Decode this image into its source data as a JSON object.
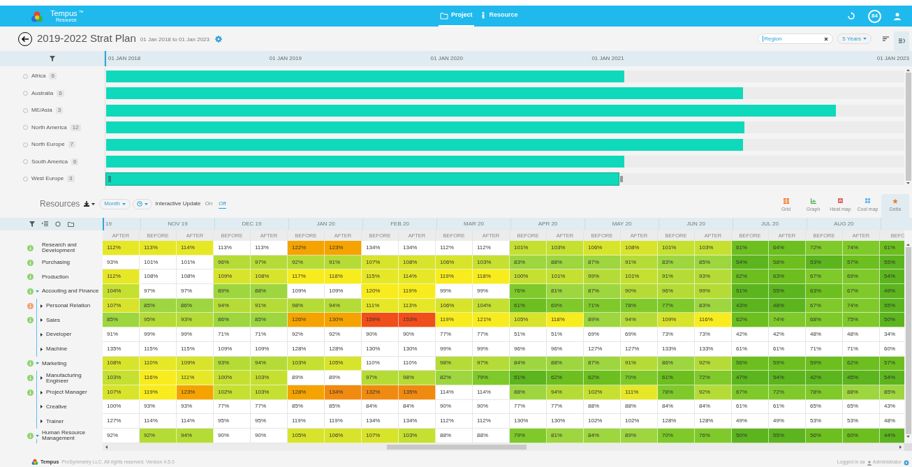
{
  "app": {
    "name": "Tempus",
    "trademark": "™",
    "subtitle": "Resource"
  },
  "nav_tabs": [
    {
      "label": "Project",
      "selected": true
    },
    {
      "label": "Resource",
      "selected": false
    }
  ],
  "notification_count": "84",
  "plan": {
    "title": "2019-2022 Strat Plan",
    "dates": "01 Jan 2018 to 01 Jan 2023"
  },
  "search": {
    "value": "Region"
  },
  "range_dropdown": "5 Years",
  "timeline": {
    "ticks": [
      "01 JAN 2018",
      "01 JAN 2019",
      "01 JAN 2020",
      "01 JAN 2021",
      "01 JAN 2023"
    ]
  },
  "regions": [
    {
      "name": "Africa",
      "count": "6",
      "checked": false,
      "selected": false,
      "level": 0.649
    },
    {
      "name": "Australia",
      "count": "6",
      "checked": false,
      "selected": false,
      "level": 0.798
    },
    {
      "name": "ME/Asia",
      "count": "3",
      "checked": false,
      "selected": false,
      "level": 0.914
    },
    {
      "name": "North America",
      "count": "12",
      "checked": false,
      "selected": false,
      "level": 0.8
    },
    {
      "name": "North Europe",
      "count": "7",
      "checked": false,
      "selected": false,
      "level": 0.798
    },
    {
      "name": "South America",
      "count": "6",
      "checked": false,
      "selected": false,
      "level": 0.649
    },
    {
      "name": "West Europe",
      "count": "3",
      "checked": false,
      "selected": true,
      "level": 0.642
    }
  ],
  "resources": {
    "title": "Resources",
    "period_dropdown": "Month",
    "interactive_update": {
      "label": "Interactive Update",
      "options": [
        {
          "label": "On",
          "selected": false
        },
        {
          "label": "Off",
          "selected": true
        }
      ]
    },
    "views": [
      {
        "label": "Grid",
        "selected": false
      },
      {
        "label": "Graph",
        "selected": false
      },
      {
        "label": "Heat map",
        "selected": false
      },
      {
        "label": "Cool map",
        "selected": false
      },
      {
        "label": "Delta",
        "selected": true
      }
    ],
    "months": [
      {
        "label": "19",
        "columns": [
          "AFTER"
        ]
      },
      {
        "label": "NOV 19",
        "columns": [
          "BEFORE",
          "AFTER"
        ]
      },
      {
        "label": "DEC 19",
        "columns": [
          "BEFORE",
          "AFTER"
        ]
      },
      {
        "label": "JAN 20",
        "columns": [
          "BEFORE",
          "AFTER"
        ]
      },
      {
        "label": "FEB 20",
        "columns": [
          "BEFORE",
          "AFTER"
        ]
      },
      {
        "label": "MAR 20",
        "columns": [
          "BEFORE",
          "AFTER"
        ]
      },
      {
        "label": "APR 20",
        "columns": [
          "BEFORE",
          "AFTER"
        ]
      },
      {
        "label": "MAY 20",
        "columns": [
          "BEFORE",
          "AFTER"
        ]
      },
      {
        "label": "JUN 20",
        "columns": [
          "BEFORE",
          "AFTER"
        ]
      },
      {
        "label": "JUL 20",
        "columns": [
          "BEFORE",
          "AFTER"
        ]
      },
      {
        "label": "AUG 20",
        "columns": [
          "BEFORE",
          "AFTER"
        ]
      },
      {
        "columns": [
          "BEFO"
        ]
      }
    ],
    "rows": [
      {
        "name": "Research and Development",
        "kind": "info",
        "cells": [
          {
            "value": "112%",
            "color": "#e6e827"
          },
          {
            "value": "113%",
            "color": "#e6e827"
          },
          {
            "value": "114%",
            "color": "#e6e827"
          },
          {
            "value": "113%"
          },
          {
            "value": "113%"
          },
          {
            "value": "122%",
            "color": "#f5a300"
          },
          {
            "value": "123%",
            "color": "#f5a300"
          },
          {
            "value": "134%"
          },
          {
            "value": "134%"
          },
          {
            "value": "112%"
          },
          {
            "value": "112%"
          },
          {
            "value": "101%",
            "color": "#c5e031"
          },
          {
            "value": "103%",
            "color": "#c5e031"
          },
          {
            "value": "106%",
            "color": "#d8e42b"
          },
          {
            "value": "108%",
            "color": "#d8e42b"
          },
          {
            "value": "101%",
            "color": "#c5e031"
          },
          {
            "value": "103%",
            "color": "#c5e031"
          },
          {
            "value": "61%",
            "color": "#6cbf1f"
          },
          {
            "value": "64%",
            "color": "#6cbf1f"
          },
          {
            "value": "72%",
            "color": "#7fca2a"
          },
          {
            "value": "74%",
            "color": "#7fca2a"
          },
          {
            "value": "61%",
            "color": "#6cbf1f"
          }
        ]
      },
      {
        "name": "Purchasing",
        "kind": "info",
        "cells": [
          {
            "value": "93%"
          },
          {
            "value": "101%"
          },
          {
            "value": "101%"
          },
          {
            "value": "96%",
            "color": "#b5dc36"
          },
          {
            "value": "97%",
            "color": "#b5dc36"
          },
          {
            "value": "92%",
            "color": "#b5dc36"
          },
          {
            "value": "91%",
            "color": "#b5dc36"
          },
          {
            "value": "107%",
            "color": "#d8e42b"
          },
          {
            "value": "108%",
            "color": "#d8e42b"
          },
          {
            "value": "106%",
            "color": "#d8e42b"
          },
          {
            "value": "103%",
            "color": "#c5e031"
          },
          {
            "value": "83%",
            "color": "#9ed63f"
          },
          {
            "value": "88%",
            "color": "#9ed63f"
          },
          {
            "value": "87%",
            "color": "#9ed63f"
          },
          {
            "value": "91%",
            "color": "#b5dc36"
          },
          {
            "value": "83%",
            "color": "#9ed63f"
          },
          {
            "value": "85%",
            "color": "#9ed63f"
          },
          {
            "value": "54%",
            "color": "#5cb51e"
          },
          {
            "value": "58%",
            "color": "#6cbf1f"
          },
          {
            "value": "53%",
            "color": "#5cb51e"
          },
          {
            "value": "57%",
            "color": "#6cbf1f"
          },
          {
            "value": "55%",
            "color": "#5cb51e"
          }
        ]
      },
      {
        "name": "Production",
        "kind": "info",
        "cells": [
          {
            "value": "112%",
            "color": "#e6e827"
          },
          {
            "value": "108%"
          },
          {
            "value": "108%"
          },
          {
            "value": "109%",
            "color": "#d8e42b"
          },
          {
            "value": "108%",
            "color": "#d8e42b"
          },
          {
            "value": "117%",
            "color": "#f8ec1e"
          },
          {
            "value": "118%",
            "color": "#f8ec1e"
          },
          {
            "value": "115%",
            "color": "#e6e827"
          },
          {
            "value": "114%",
            "color": "#e6e827"
          },
          {
            "value": "119%",
            "color": "#f8ec1e"
          },
          {
            "value": "118%",
            "color": "#f8ec1e"
          },
          {
            "value": "100%",
            "color": "#c5e031"
          },
          {
            "value": "101%",
            "color": "#c5e031"
          },
          {
            "value": "99%",
            "color": "#b5dc36"
          },
          {
            "value": "101%",
            "color": "#c5e031"
          },
          {
            "value": "91%",
            "color": "#b5dc36"
          },
          {
            "value": "93%",
            "color": "#b5dc36"
          },
          {
            "value": "62%",
            "color": "#6cbf1f"
          },
          {
            "value": "63%",
            "color": "#6cbf1f"
          },
          {
            "value": "67%",
            "color": "#7fca2a"
          },
          {
            "value": "69%",
            "color": "#7fca2a"
          },
          {
            "value": "54%",
            "color": "#5cb51e"
          }
        ]
      },
      {
        "name": "Accouting and Finance",
        "kind": "info",
        "expanded": true,
        "cells": [
          {
            "value": "104%",
            "color": "#c5e031"
          },
          {
            "value": "97%"
          },
          {
            "value": "97%"
          },
          {
            "value": "89%",
            "color": "#9ed63f"
          },
          {
            "value": "88%",
            "color": "#9ed63f"
          },
          {
            "value": "109%"
          },
          {
            "value": "109%"
          },
          {
            "value": "120%",
            "color": "#f8ec1e"
          },
          {
            "value": "119%",
            "color": "#f8ec1e"
          },
          {
            "value": "99%"
          },
          {
            "value": "99%"
          },
          {
            "value": "76%",
            "color": "#7fca2a"
          },
          {
            "value": "81%",
            "color": "#9ed63f"
          },
          {
            "value": "87%",
            "color": "#9ed63f"
          },
          {
            "value": "90%",
            "color": "#b5dc36"
          },
          {
            "value": "96%",
            "color": "#b5dc36"
          },
          {
            "value": "99%",
            "color": "#b5dc36"
          },
          {
            "value": "51%",
            "color": "#5cb51e"
          },
          {
            "value": "55%",
            "color": "#5cb51e"
          },
          {
            "value": "63%",
            "color": "#6cbf1f"
          },
          {
            "value": "67%",
            "color": "#7fca2a"
          },
          {
            "value": "49%",
            "color": "#5cb51e"
          }
        ],
        "children": [
          {
            "name": "Personal Relation",
            "kind": "warning",
            "expanded": false,
            "cells": [
              {
                "value": "107%",
                "color": "#d8e42b"
              },
              {
                "value": "85%",
                "color": "#9ed63f"
              },
              {
                "value": "86%",
                "color": "#9ed63f"
              },
              {
                "value": "94%",
                "color": "#b5dc36"
              },
              {
                "value": "91%",
                "color": "#b5dc36"
              },
              {
                "value": "98%",
                "color": "#b5dc36"
              },
              {
                "value": "94%",
                "color": "#b5dc36"
              },
              {
                "value": "111%",
                "color": "#e6e827"
              },
              {
                "value": "113%",
                "color": "#e6e827"
              },
              {
                "value": "106%",
                "color": "#d8e42b"
              },
              {
                "value": "104%",
                "color": "#c5e031"
              },
              {
                "value": "61%",
                "color": "#6cbf1f"
              },
              {
                "value": "69%",
                "color": "#7fca2a"
              },
              {
                "value": "71%",
                "color": "#7fca2a"
              },
              {
                "value": "78%",
                "color": "#7fca2a"
              },
              {
                "value": "77%",
                "color": "#7fca2a"
              },
              {
                "value": "83%",
                "color": "#9ed63f"
              },
              {
                "value": "43%",
                "color": "#5cb51e"
              },
              {
                "value": "48%",
                "color": "#5cb51e"
              },
              {
                "value": "67%",
                "color": "#7fca2a"
              },
              {
                "value": "74%",
                "color": "#7fca2a"
              },
              {
                "value": "55%",
                "color": "#5cb51e"
              }
            ]
          },
          {
            "name": "Sales",
            "kind": "info",
            "expanded": false,
            "cells": [
              {
                "value": "85%",
                "color": "#9ed63f"
              },
              {
                "value": "95%",
                "color": "#b5dc36"
              },
              {
                "value": "93%",
                "color": "#b5dc36"
              },
              {
                "value": "86%",
                "color": "#9ed63f"
              },
              {
                "value": "85%",
                "color": "#9ed63f"
              },
              {
                "value": "126%",
                "color": "#f5a300"
              },
              {
                "value": "130%",
                "color": "#f5a300"
              },
              {
                "value": "159%",
                "color": "#f04e1a"
              },
              {
                "value": "153%",
                "color": "#f04e1a"
              },
              {
                "value": "119%",
                "color": "#f8ec1e"
              },
              {
                "value": "121%",
                "color": "#f8ec1e"
              },
              {
                "value": "105%",
                "color": "#d8e42b"
              },
              {
                "value": "118%",
                "color": "#f8ec1e"
              },
              {
                "value": "89%",
                "color": "#9ed63f"
              },
              {
                "value": "94%",
                "color": "#b5dc36"
              },
              {
                "value": "109%",
                "color": "#d8e42b"
              },
              {
                "value": "116%",
                "color": "#f8ec1e"
              },
              {
                "value": "62%",
                "color": "#6cbf1f"
              },
              {
                "value": "74%",
                "color": "#7fca2a"
              },
              {
                "value": "68%",
                "color": "#7fca2a"
              },
              {
                "value": "75%",
                "color": "#7fca2a"
              },
              {
                "value": "50%",
                "color": "#5cb51e"
              }
            ]
          },
          {
            "name": "Developer",
            "kind": "plain",
            "expanded": false,
            "cells": [
              {
                "value": "91%"
              },
              {
                "value": "99%"
              },
              {
                "value": "99%"
              },
              {
                "value": "71%"
              },
              {
                "value": "71%"
              },
              {
                "value": "92%"
              },
              {
                "value": "92%"
              },
              {
                "value": "90%"
              },
              {
                "value": "90%"
              },
              {
                "value": "77%"
              },
              {
                "value": "77%"
              },
              {
                "value": "51%"
              },
              {
                "value": "51%"
              },
              {
                "value": "69%"
              },
              {
                "value": "69%"
              },
              {
                "value": "73%"
              },
              {
                "value": "73%"
              },
              {
                "value": "42%"
              },
              {
                "value": "42%"
              },
              {
                "value": "48%"
              },
              {
                "value": "48%"
              },
              {
                "value": "34%"
              }
            ]
          },
          {
            "name": "Machine",
            "kind": "plain",
            "expanded": false,
            "cells": [
              {
                "value": "135%"
              },
              {
                "value": "115%"
              },
              {
                "value": "115%"
              },
              {
                "value": "109%"
              },
              {
                "value": "109%"
              },
              {
                "value": "128%"
              },
              {
                "value": "128%"
              },
              {
                "value": "130%"
              },
              {
                "value": "130%"
              },
              {
                "value": "99%"
              },
              {
                "value": "99%"
              },
              {
                "value": "96%"
              },
              {
                "value": "96%"
              },
              {
                "value": "127%"
              },
              {
                "value": "127%"
              },
              {
                "value": "133%"
              },
              {
                "value": "133%"
              },
              {
                "value": "61%"
              },
              {
                "value": "61%"
              },
              {
                "value": "71%"
              },
              {
                "value": "71%"
              },
              {
                "value": "60%"
              }
            ]
          }
        ]
      },
      {
        "name": "Marketing",
        "kind": "info",
        "expanded": true,
        "cells": [
          {
            "value": "108%",
            "color": "#d8e42b"
          },
          {
            "value": "110%",
            "color": "#e6e827"
          },
          {
            "value": "109%",
            "color": "#d8e42b"
          },
          {
            "value": "93%",
            "color": "#b5dc36"
          },
          {
            "value": "94%",
            "color": "#b5dc36"
          },
          {
            "value": "103%",
            "color": "#c5e031"
          },
          {
            "value": "105%",
            "color": "#d8e42b"
          },
          {
            "value": "110%"
          },
          {
            "value": "110%"
          },
          {
            "value": "98%",
            "color": "#b5dc36"
          },
          {
            "value": "97%",
            "color": "#b5dc36"
          },
          {
            "value": "84%",
            "color": "#9ed63f"
          },
          {
            "value": "88%",
            "color": "#9ed63f"
          },
          {
            "value": "87%",
            "color": "#9ed63f"
          },
          {
            "value": "91%",
            "color": "#b5dc36"
          },
          {
            "value": "86%",
            "color": "#9ed63f"
          },
          {
            "value": "92%",
            "color": "#b5dc36"
          },
          {
            "value": "56%",
            "color": "#6cbf1f"
          },
          {
            "value": "59%",
            "color": "#6cbf1f"
          },
          {
            "value": "59%",
            "color": "#6cbf1f"
          },
          {
            "value": "62%",
            "color": "#6cbf1f"
          },
          {
            "value": "57%",
            "color": "#6cbf1f"
          }
        ],
        "children": [
          {
            "name": "Manufacturing Engineer",
            "kind": "info",
            "expanded": false,
            "cells": [
              {
                "value": "103%",
                "color": "#c5e031"
              },
              {
                "value": "116%",
                "color": "#f8ec1e"
              },
              {
                "value": "111%",
                "color": "#e6e827"
              },
              {
                "value": "100%",
                "color": "#c5e031"
              },
              {
                "value": "103%",
                "color": "#c5e031"
              },
              {
                "value": "89%"
              },
              {
                "value": "89%"
              },
              {
                "value": "97%",
                "color": "#b5dc36"
              },
              {
                "value": "98%",
                "color": "#b5dc36"
              },
              {
                "value": "82%",
                "color": "#9ed63f"
              },
              {
                "value": "79%",
                "color": "#7fca2a"
              },
              {
                "value": "51%",
                "color": "#5cb51e"
              },
              {
                "value": "62%",
                "color": "#6cbf1f"
              },
              {
                "value": "62%",
                "color": "#6cbf1f"
              },
              {
                "value": "70%",
                "color": "#7fca2a"
              },
              {
                "value": "61%",
                "color": "#6cbf1f"
              },
              {
                "value": "72%",
                "color": "#7fca2a"
              },
              {
                "value": "47%",
                "color": "#5cb51e"
              },
              {
                "value": "54%",
                "color": "#5cb51e"
              },
              {
                "value": "42%",
                "color": "#5cb51e"
              },
              {
                "value": "45%",
                "color": "#5cb51e"
              },
              {
                "value": "54%",
                "color": "#5cb51e"
              }
            ]
          },
          {
            "name": "Project Manager",
            "kind": "info",
            "expanded": false,
            "cells": [
              {
                "value": "107%",
                "color": "#d8e42b"
              },
              {
                "value": "119%",
                "color": "#f8ec1e"
              },
              {
                "value": "123%",
                "color": "#f5a300"
              },
              {
                "value": "102%",
                "color": "#c5e031"
              },
              {
                "value": "103%",
                "color": "#c5e031"
              },
              {
                "value": "128%",
                "color": "#f5a300"
              },
              {
                "value": "134%",
                "color": "#f08a10"
              },
              {
                "value": "132%",
                "color": "#f08a10"
              },
              {
                "value": "135%",
                "color": "#f08a10"
              },
              {
                "value": "114%"
              },
              {
                "value": "114%"
              },
              {
                "value": "88%",
                "color": "#9ed63f"
              },
              {
                "value": "94%",
                "color": "#b5dc36"
              },
              {
                "value": "102%",
                "color": "#c5e031"
              },
              {
                "value": "111%",
                "color": "#e6e827"
              },
              {
                "value": "78%",
                "color": "#7fca2a"
              },
              {
                "value": "92%",
                "color": "#b5dc36"
              },
              {
                "value": "67%",
                "color": "#7fca2a"
              },
              {
                "value": "72%",
                "color": "#7fca2a"
              },
              {
                "value": "78%",
                "color": "#7fca2a"
              },
              {
                "value": "88%",
                "color": "#9ed63f"
              },
              {
                "value": "85%",
                "color": "#9ed63f"
              }
            ]
          },
          {
            "name": "Creative",
            "kind": "plain",
            "expanded": false,
            "cells": [
              {
                "value": "100%"
              },
              {
                "value": "93%"
              },
              {
                "value": "93%"
              },
              {
                "value": "77%"
              },
              {
                "value": "77%"
              },
              {
                "value": "85%"
              },
              {
                "value": "85%"
              },
              {
                "value": "84%"
              },
              {
                "value": "84%"
              },
              {
                "value": "90%"
              },
              {
                "value": "90%"
              },
              {
                "value": "77%"
              },
              {
                "value": "77%"
              },
              {
                "value": "88%"
              },
              {
                "value": "88%"
              },
              {
                "value": "84%"
              },
              {
                "value": "84%"
              },
              {
                "value": "61%"
              },
              {
                "value": "61%"
              },
              {
                "value": "65%"
              },
              {
                "value": "65%"
              },
              {
                "value": "43%"
              }
            ]
          },
          {
            "name": "Trainer",
            "kind": "plain",
            "expanded": false,
            "cells": [
              {
                "value": "127%"
              },
              {
                "value": "114%"
              },
              {
                "value": "114%"
              },
              {
                "value": "95%"
              },
              {
                "value": "95%"
              },
              {
                "value": "119%"
              },
              {
                "value": "119%"
              },
              {
                "value": "134%"
              },
              {
                "value": "134%"
              },
              {
                "value": "112%"
              },
              {
                "value": "112%"
              },
              {
                "value": "130%"
              },
              {
                "value": "130%"
              },
              {
                "value": "102%"
              },
              {
                "value": "102%"
              },
              {
                "value": "128%"
              },
              {
                "value": "128%"
              },
              {
                "value": "49%"
              },
              {
                "value": "49%"
              },
              {
                "value": "53%"
              },
              {
                "value": "53%"
              },
              {
                "value": "48%"
              }
            ]
          }
        ]
      },
      {
        "name": "Human Resource Management",
        "kind": "info",
        "expanded": true,
        "cells": [
          {
            "value": "92%"
          },
          {
            "value": "92%",
            "color": "#b5dc36"
          },
          {
            "value": "94%",
            "color": "#b5dc36"
          },
          {
            "value": "90%"
          },
          {
            "value": "90%"
          },
          {
            "value": "105%",
            "color": "#d8e42b"
          },
          {
            "value": "106%",
            "color": "#d8e42b"
          },
          {
            "value": "107%",
            "color": "#d8e42b"
          },
          {
            "value": "103%",
            "color": "#c5e031"
          },
          {
            "value": "88%"
          },
          {
            "value": "88%"
          },
          {
            "value": "79%",
            "color": "#7fca2a"
          },
          {
            "value": "81%",
            "color": "#9ed63f"
          },
          {
            "value": "84%",
            "color": "#9ed63f"
          },
          {
            "value": "89%",
            "color": "#9ed63f"
          },
          {
            "value": "70%",
            "color": "#7fca2a"
          },
          {
            "value": "76%",
            "color": "#7fca2a"
          },
          {
            "value": "50%",
            "color": "#5cb51e"
          },
          {
            "value": "55%",
            "color": "#5cb51e"
          },
          {
            "value": "56%",
            "color": "#6cbf1f"
          },
          {
            "value": "60%",
            "color": "#6cbf1f"
          },
          {
            "value": "44%",
            "color": "#5cb51e"
          }
        ]
      }
    ]
  },
  "footer": {
    "brand": "Tempus",
    "copyright": "ProSymmetry LLC. All rights reserved. Version 4.5.0",
    "logged_in_label": "Logged in as",
    "user": "Administrator"
  }
}
